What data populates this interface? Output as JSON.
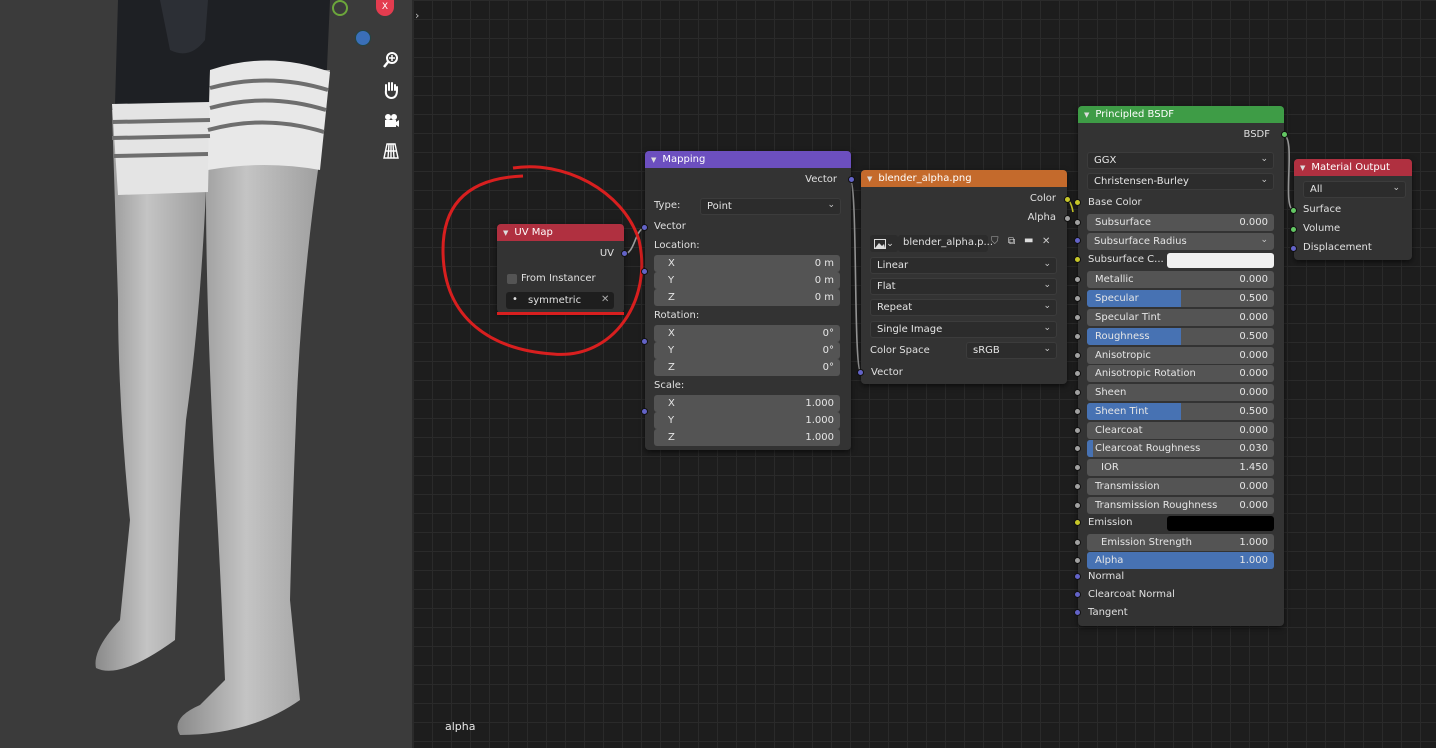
{
  "viewport": {
    "axis_x_label": "X",
    "overlay_text": "alpha"
  },
  "uvmap": {
    "title": "UV Map",
    "output": "UV",
    "checkbox_label": "From Instancer",
    "uv_name": "symmetric"
  },
  "mapping": {
    "title": "Mapping",
    "output": "Vector",
    "type_label": "Type:",
    "type_value": "Point",
    "vector_input": "Vector",
    "location_label": "Location:",
    "rotation_label": "Rotation:",
    "scale_label": "Scale:",
    "location": [
      {
        "axis": "X",
        "value": "0 m"
      },
      {
        "axis": "Y",
        "value": "0 m"
      },
      {
        "axis": "Z",
        "value": "0 m"
      }
    ],
    "rotation": [
      {
        "axis": "X",
        "value": "0°"
      },
      {
        "axis": "Y",
        "value": "0°"
      },
      {
        "axis": "Z",
        "value": "0°"
      }
    ],
    "scale": [
      {
        "axis": "X",
        "value": "1.000"
      },
      {
        "axis": "Y",
        "value": "1.000"
      },
      {
        "axis": "Z",
        "value": "1.000"
      }
    ]
  },
  "image": {
    "title": "blender_alpha.png",
    "out_color": "Color",
    "out_alpha": "Alpha",
    "image_name": "blender_alpha.p...",
    "interpolation": "Linear",
    "projection": "Flat",
    "extension": "Repeat",
    "source": "Single Image",
    "colorspace_label": "Color Space",
    "colorspace_value": "sRGB",
    "vector_input": "Vector"
  },
  "bsdf": {
    "title": "Principled BSDF",
    "output": "BSDF",
    "distribution": "GGX",
    "subsurface_method": "Christensen-Burley",
    "base_color": "Base Color",
    "subsurface_radius": "Subsurface Radius",
    "subsurface_color": "Subsurface C...",
    "emission": "Emission",
    "normal": "Normal",
    "clearcoat_normal": "Clearcoat Normal",
    "tangent": "Tangent",
    "fields": [
      {
        "label": "Subsurface",
        "value": "0.000",
        "fill": 0
      },
      {
        "label": "Metallic",
        "value": "0.000",
        "fill": 0
      },
      {
        "label": "Specular",
        "value": "0.500",
        "fill": 0.5
      },
      {
        "label": "Specular Tint",
        "value": "0.000",
        "fill": 0
      },
      {
        "label": "Roughness",
        "value": "0.500",
        "fill": 0.5
      },
      {
        "label": "Anisotropic",
        "value": "0.000",
        "fill": 0
      },
      {
        "label": "Anisotropic Rotation",
        "value": "0.000",
        "fill": 0
      },
      {
        "label": "Sheen",
        "value": "0.000",
        "fill": 0
      },
      {
        "label": "Sheen Tint",
        "value": "0.500",
        "fill": 0.5
      },
      {
        "label": "Clearcoat",
        "value": "0.000",
        "fill": 0
      },
      {
        "label": "Clearcoat Roughness",
        "value": "0.030",
        "fill": 0.03
      },
      {
        "label": "IOR",
        "value": "1.450",
        "fill": 0
      },
      {
        "label": "Transmission",
        "value": "0.000",
        "fill": 0
      },
      {
        "label": "Transmission Roughness",
        "value": "0.000",
        "fill": 0
      },
      {
        "label": "Emission Strength",
        "value": "1.000",
        "fill": 0
      },
      {
        "label": "Alpha",
        "value": "1.000",
        "fill": 1
      }
    ]
  },
  "matout": {
    "title": "Material Output",
    "target": "All",
    "surface": "Surface",
    "volume": "Volume",
    "displacement": "Displacement"
  },
  "colors": {
    "uvmap_header": "#b03040",
    "mapping_header": "#6c4fbf",
    "image_header": "#c46a2c",
    "bsdf_header": "#3e9c46",
    "matout_header": "#b03040",
    "accent": "#4772b3",
    "annotation": "#d81f1f"
  }
}
